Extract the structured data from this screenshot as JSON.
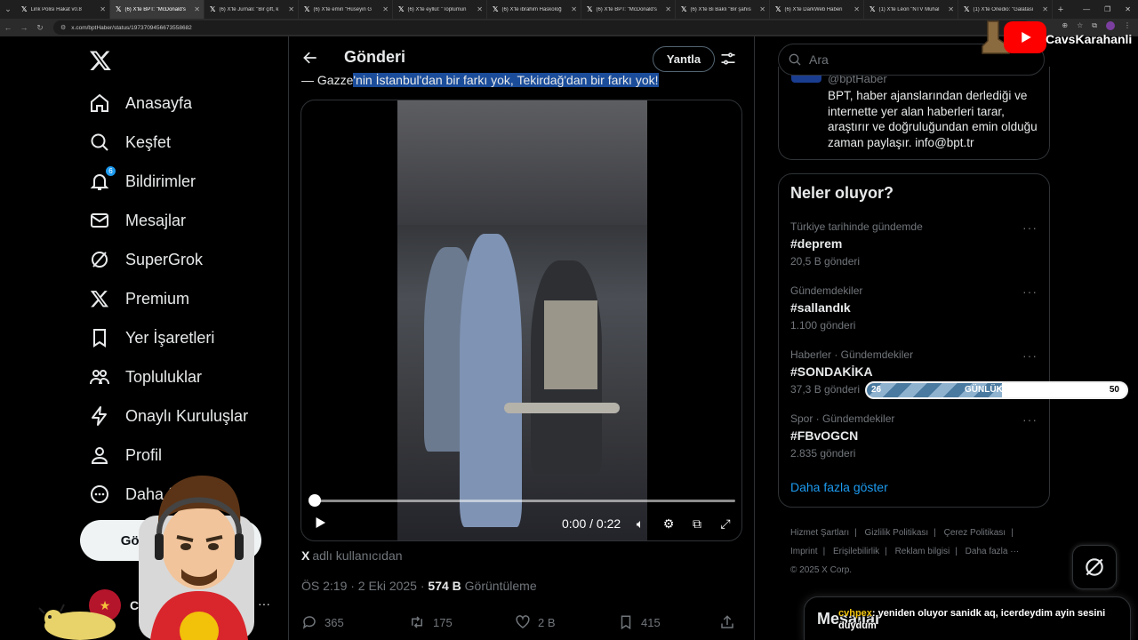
{
  "browser": {
    "tabs": [
      {
        "title": "Link Polisi Hakat v0.8",
        "active": false
      },
      {
        "title": "(6) X'te BPT: \"McDonald's",
        "active": true
      },
      {
        "title": "(6) X'te Jurnali: \"Bir çift, k",
        "active": false
      },
      {
        "title": "(6) X'te emin \"Hüseyin G",
        "active": false
      },
      {
        "title": "(6) X'te eyllül: \"Toplumun",
        "active": false
      },
      {
        "title": "(6) X'te ibrahim Haskoloğ",
        "active": false
      },
      {
        "title": "(6) X'te BPT: \"McDonald's",
        "active": false
      },
      {
        "title": "(6) X'te Bi Baklı \"Bir şahıs",
        "active": false
      },
      {
        "title": "(6) X'te DarkWeb Haberi",
        "active": false
      },
      {
        "title": "(1) X'te Léon \"NTV Muhal",
        "active": false
      },
      {
        "title": "(1) X'te Onedio: \"Galatası",
        "active": false
      }
    ],
    "url": "x.com/bptHaber/status/1973709456673558682"
  },
  "nav": {
    "items": [
      {
        "label": "Anasayfa"
      },
      {
        "label": "Keşfet"
      },
      {
        "label": "Bildirimler",
        "badge": "6"
      },
      {
        "label": "Mesajlar"
      },
      {
        "label": "SuperGrok"
      },
      {
        "label": "Premium"
      },
      {
        "label": "Yer İşaretleri"
      },
      {
        "label": "Topluluklar"
      },
      {
        "label": "Onaylı Kuruluşlar"
      },
      {
        "label": "Profil"
      },
      {
        "label": "Daha fazla"
      }
    ],
    "post_button": "Gönderi yayınla",
    "account_name": "Câ"
  },
  "main": {
    "title": "Gönderi",
    "reply_button": "Yantla",
    "quote_prefix": "— Gazze",
    "quote_highlight": "'nin İstanbul'dan bir farkı yok, Tekirdağ'dan bir farkı yok!",
    "video": {
      "progress": 0,
      "time": "0:00 / 0:22"
    },
    "source_x": "X",
    "source_text": "adlı kullanıcıdan",
    "meta_time": "ÖS 2:19 · 2 Eki 2025 ·",
    "views_count": "574 B",
    "views_label": "Görüntüleme",
    "actions": {
      "replies": "365",
      "reposts": "175",
      "likes": "2 B",
      "bookmarks": "415"
    }
  },
  "right": {
    "search_placeholder": "Ara",
    "bio_handle": "@bptHaber",
    "bio_text": "BPT, haber ajanslarından derlediği ve internette yer alan haberleri tarar, araştırır ve doğruluğundan emin olduğu zaman paylaşır. info@bpt.tr",
    "trends_title": "Neler oluyor?",
    "trends": [
      {
        "context": "Türkiye tarihinde gündemde",
        "tag": "#deprem",
        "count": "20,5 B gönderi"
      },
      {
        "context": "Gündemdekiler",
        "tag": "#sallandık",
        "count": "1.100 gönderi"
      },
      {
        "context": "Haberler · Gündemdekiler",
        "tag": "#SONDAKİKA",
        "count": "37,3 B gönderi"
      },
      {
        "context": "Spor · Gündemdekiler",
        "tag": "#FBvOGCN",
        "count": "2.835 gönderi"
      }
    ],
    "show_more": "Daha fazla göster",
    "footer": [
      "Hizmet Şartları",
      "Gizlilik Politikası",
      "Çerez Politikası",
      "Imprint",
      "Erişilebilirlik",
      "Reklam bilgisi",
      "Daha fazla ···",
      "© 2025 X Corp."
    ],
    "messages_title": "Mesajlar"
  },
  "overlay": {
    "channel_name": "CavsKarahanli",
    "sub_goal": {
      "current": "26",
      "label": "GÜNLÜK SUB",
      "target": "50",
      "fraction": 0.52
    },
    "chat_user": "cvhpex",
    "chat_message": ": yeniden oluyor sanidk aq, icerdeydim ayin sesini duydum"
  },
  "colors": {
    "accent": "#1d9bf0",
    "background": "#000000",
    "border": "#2f3336",
    "muted": "#71767b"
  }
}
